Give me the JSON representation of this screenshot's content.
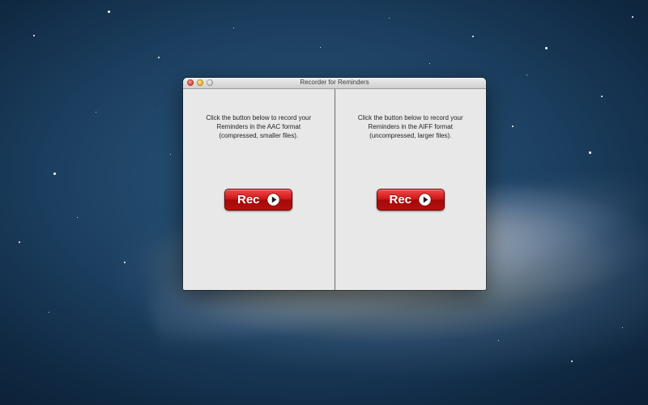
{
  "window": {
    "title": "Recorder for Reminders"
  },
  "panes": [
    {
      "lines": [
        "Click the button below to record your",
        "Reminders in the AAC format",
        "(compressed, smaller files)."
      ],
      "button_label": "Rec",
      "button_icon": "play-circle-icon"
    },
    {
      "lines": [
        "Click the button below to record your",
        "Reminders in the AIFF format",
        "(uncompressed, larger files)."
      ],
      "button_label": "Rec",
      "button_icon": "play-circle-icon"
    }
  ],
  "colors": {
    "button_red": "#cf1414",
    "window_bg": "#e8e8e8",
    "close": "#e1453c",
    "minimize": "#f2b632",
    "zoom": "#c9c9c9"
  }
}
